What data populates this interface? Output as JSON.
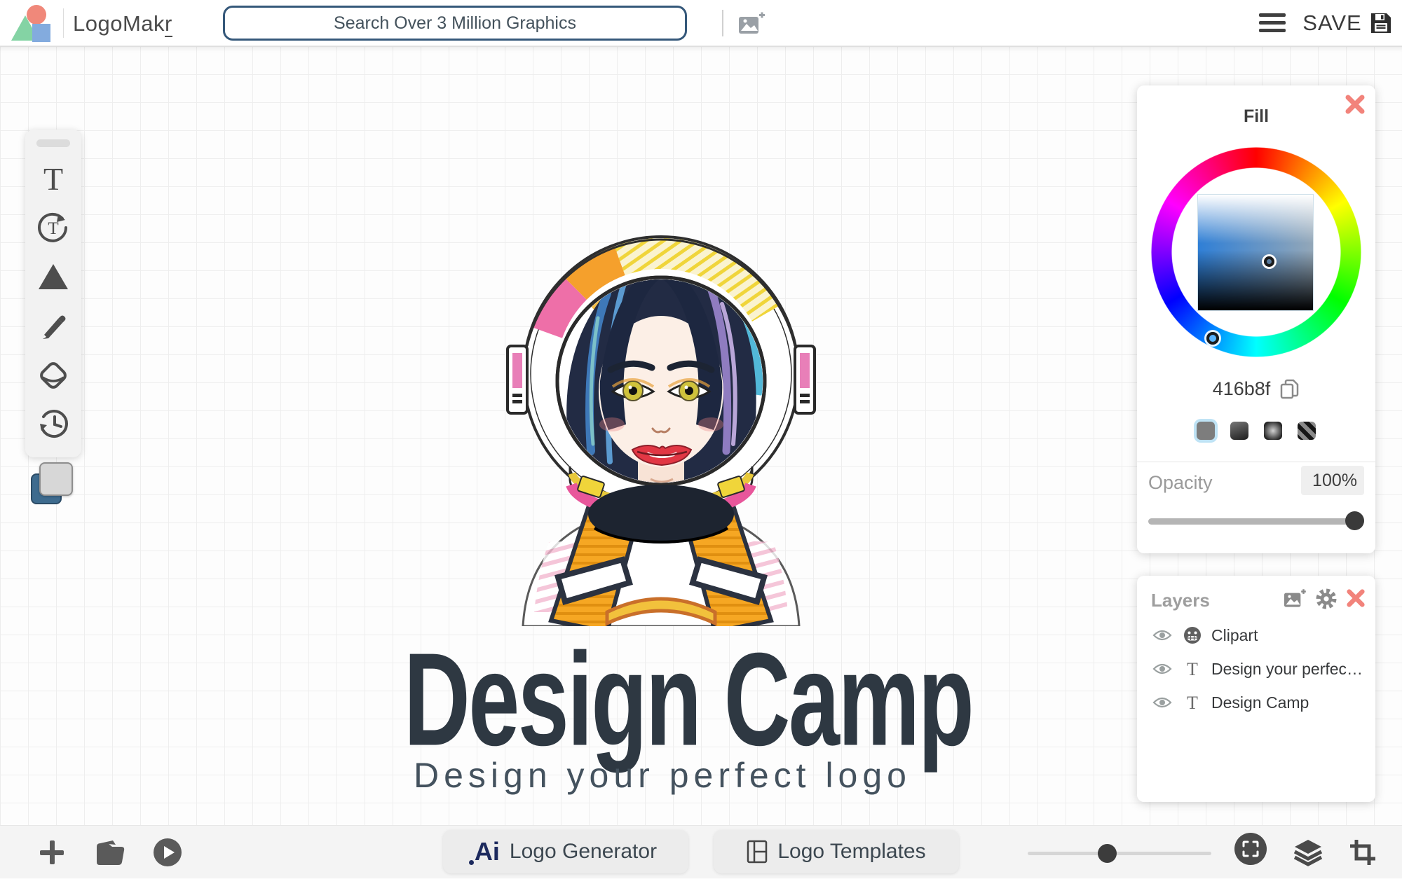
{
  "header": {
    "brand_prefix": "LogoMak",
    "brand_suffix": "r",
    "search_placeholder": "Search Over 3 Million Graphics",
    "save_label": "SAVE"
  },
  "canvas": {
    "logo_title": "Design Camp",
    "logo_tagline": "Design your perfect logo"
  },
  "fill_panel": {
    "title": "Fill",
    "hex_value": "416b8f",
    "opacity_label": "Opacity",
    "opacity_value": "100%"
  },
  "layers_panel": {
    "title": "Layers",
    "layers": [
      {
        "type": "clipart",
        "label": "Clipart"
      },
      {
        "type": "text",
        "label": "Design your perfec…"
      },
      {
        "type": "text",
        "label": "Design Camp"
      }
    ]
  },
  "footer": {
    "ai_mark": "Ai",
    "generator_label": "Logo Generator",
    "templates_label": "Logo Templates"
  },
  "colors": {
    "accent_close": "#F2837B",
    "selected_fill": "#416b8f",
    "swatch_selected_ring": "#BFE3F5",
    "logo_green": "#84D3A4",
    "logo_salmon": "#F0887A",
    "logo_blue": "#83ABDE",
    "title_text": "#2E3842"
  }
}
